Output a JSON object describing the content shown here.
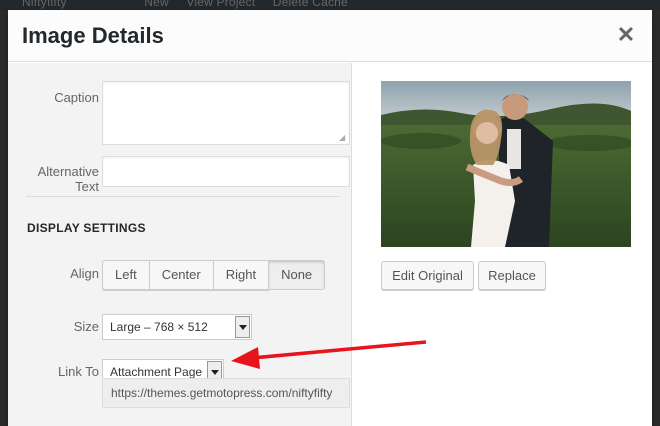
{
  "admin_bar": {
    "items": [
      "Niftyfifty",
      "New",
      "View Project",
      "Delete Cache"
    ]
  },
  "modal": {
    "title": "Image Details",
    "close_glyph": "✕"
  },
  "settings": {
    "caption_label": "Caption",
    "caption_value": "",
    "alt_label_line1": "Alternative",
    "alt_label_line2": "Text",
    "alt_value": "",
    "display_heading": "DISPLAY SETTINGS",
    "align_label": "Align",
    "align_options": [
      "Left",
      "Center",
      "Right",
      "None"
    ],
    "align_selected": "None",
    "size_label": "Size",
    "size_value": "Large – 768 × 512",
    "link_label": "Link To",
    "link_value": "Attachment Page",
    "link_url": "https://themes.getmotopress.com/niftyfifty"
  },
  "preview": {
    "edit_original_label": "Edit Original",
    "replace_label": "Replace"
  },
  "icons": {
    "close": "close-icon",
    "resize": "resize-grip-icon",
    "dropdown": "chevron-down-icon",
    "annotation": "red-arrow-icon"
  },
  "colors": {
    "annotation_arrow": "#e8141b",
    "title": "#23282d"
  }
}
